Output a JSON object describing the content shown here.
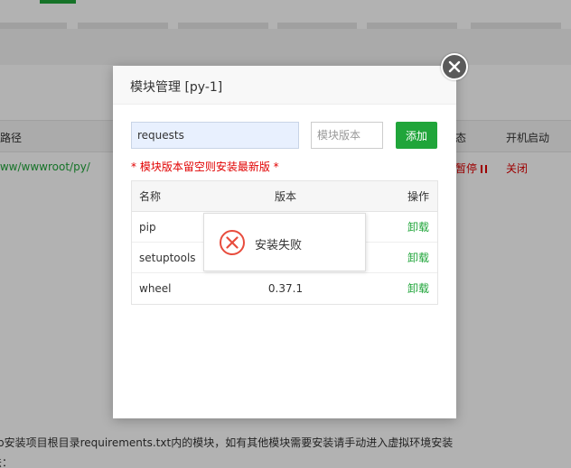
{
  "background": {
    "column_headers": {
      "path": "路径",
      "status": "态",
      "autostart": "开机启动"
    },
    "row": {
      "path": "/www/wwwroot/py/",
      "status": "暂停",
      "autostart": "关闭"
    },
    "footer_notes": [
      "pip安装项目根目录requirements.txt内的模块，如有其他模块需要安装请手动进入虚拟环境安装",
      "法："
    ]
  },
  "modal": {
    "title": "模块管理 [py-1]",
    "name_input_value": "requests",
    "version_placeholder": "模块版本",
    "add_label": "添加",
    "hint": "* 模块版本留空则安装最新版 *",
    "table": {
      "headers": {
        "name": "名称",
        "version": "版本",
        "action": "操作"
      },
      "rows": [
        {
          "name": "pip",
          "version": "",
          "action": "卸载"
        },
        {
          "name": "setuptools",
          "version": "",
          "action": "卸载"
        },
        {
          "name": "wheel",
          "version": "0.37.1",
          "action": "卸载"
        }
      ]
    }
  },
  "toast": {
    "message": "安装失败",
    "icon": "error-x-circle-icon"
  },
  "colors": {
    "accent": "#20a53a",
    "error": "#e10000",
    "toast_icon": "#e84c3d"
  }
}
